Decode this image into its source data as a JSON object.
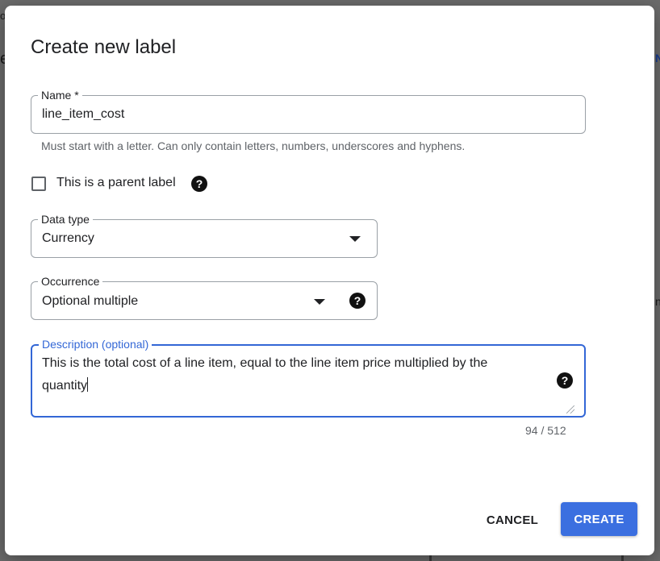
{
  "background": {
    "fragments": [
      "o",
      "e",
      "N",
      "n"
    ]
  },
  "dialog": {
    "title": "Create new label",
    "name_field": {
      "label": "Name *",
      "value": "line_item_cost",
      "hint": "Must start with a letter. Can only contain letters, numbers, underscores and hyphens."
    },
    "parent_checkbox": {
      "label": "This is a parent label",
      "checked": false
    },
    "data_type": {
      "label": "Data type",
      "value": "Currency"
    },
    "occurrence": {
      "label": "Occurrence",
      "value": "Optional multiple"
    },
    "description": {
      "label": "Description (optional)",
      "value_line1": "This is the total cost of a line item, equal to the line item price multiplied by the",
      "value_line2": "quantity",
      "counter": "94 / 512"
    },
    "buttons": {
      "cancel": "CANCEL",
      "create": "CREATE"
    },
    "help_glyph": "?"
  },
  "colors": {
    "accent": "#3b6fe0",
    "focus_border": "#3367d6",
    "overlay": "#5f5f5f"
  },
  "icons": {
    "help": "help-circle-icon",
    "dropdown": "chevron-down-icon",
    "checkbox": "checkbox-outline-icon"
  }
}
